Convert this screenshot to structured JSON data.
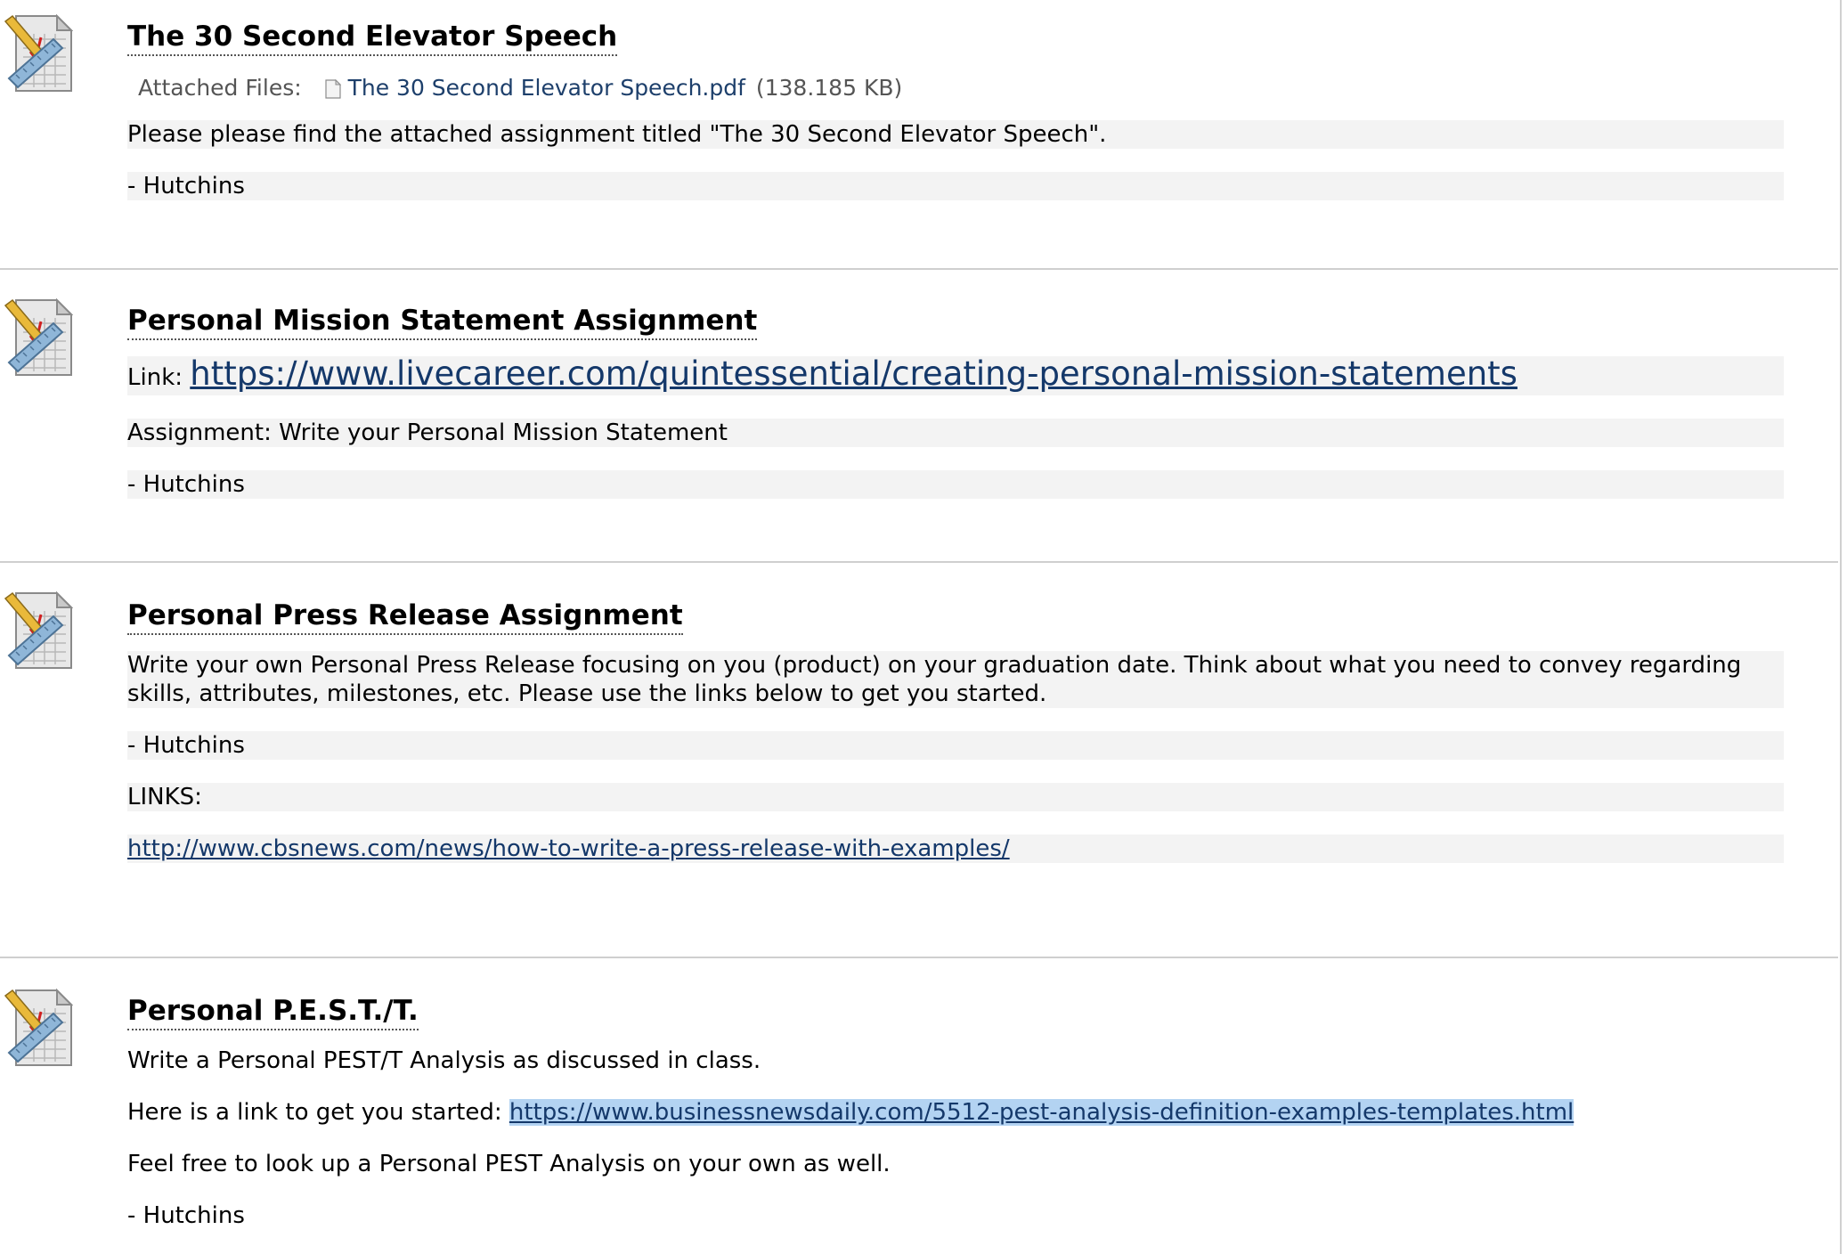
{
  "items": [
    {
      "title": "The 30 Second Elevator Speech",
      "attached_label": "Attached Files:",
      "file_name": "The 30 Second Elevator Speech.pdf",
      "file_size": "(138.185 KB)",
      "paragraphs": [
        "Please please find the attached assignment titled \"The 30 Second Elevator Speech\".",
        "- Hutchins"
      ]
    },
    {
      "title": "Personal Mission Statement Assignment",
      "link_prefix": "Link: ",
      "link_url": "https://www.livecareer.com/quintessential/creating-personal-mission-statements",
      "paragraphs": [
        "Assignment: Write your Personal Mission Statement",
        "- Hutchins"
      ]
    },
    {
      "title": "Personal Press Release Assignment",
      "paragraphs": [
        "Write your own Personal Press Release focusing on you (product) on your graduation date. Think about what you need to convey regarding skills, attributes, milestones, etc. Please use the links below to get you started.",
        "- Hutchins",
        "LINKS:"
      ],
      "link_url": "http://www.cbsnews.com/news/how-to-write-a-press-release-with-examples/"
    },
    {
      "title": "Personal P.E.S.T./T.",
      "paragraphs": [
        "Write a Personal PEST/T Analysis as discussed in class."
      ],
      "link_prefix": "Here is a link to get you started: ",
      "link_url": "https://www.businessnewsdaily.com/5512-pest-analysis-definition-examples-templates.html",
      "paragraphs_after": [
        "Feel free to look up a Personal PEST Analysis on your own as well.",
        "- Hutchins"
      ]
    }
  ],
  "icons": {
    "item_icon": "assignment-ruler-pencil-icon",
    "file_icon": "document-file-icon"
  },
  "colors": {
    "link": "#14386a",
    "paragraph_bg": "#f3f3f3",
    "selection": "#b3d3f2",
    "divider": "#cfcfcf"
  }
}
